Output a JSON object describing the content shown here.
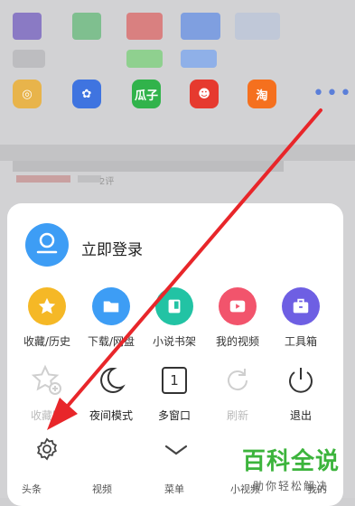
{
  "login": {
    "label": "立即登录"
  },
  "menu_row1": [
    {
      "label": "收藏/历史",
      "icon": "star-icon",
      "color": "#f5b826"
    },
    {
      "label": "下载/网盘",
      "icon": "folder-icon",
      "color": "#3d9df5"
    },
    {
      "label": "小说书架",
      "icon": "book-icon",
      "color": "#22c3a4"
    },
    {
      "label": "我的视频",
      "icon": "play-icon",
      "color": "#f2546c"
    },
    {
      "label": "工具箱",
      "icon": "toolbox-icon",
      "color": "#6e5fe3"
    }
  ],
  "menu_row2": [
    {
      "label": "收藏网",
      "icon": "star-add-icon",
      "enabled": false
    },
    {
      "label": "夜间模式",
      "icon": "moon-icon",
      "enabled": true
    },
    {
      "label": "多窗口",
      "icon": "window-count-icon",
      "count": "1",
      "enabled": true
    },
    {
      "label": "刷新",
      "icon": "refresh-icon",
      "enabled": false
    },
    {
      "label": "退出",
      "icon": "power-icon",
      "enabled": true
    }
  ],
  "bottom_bar": {
    "settings_icon": "gear-icon",
    "collapse_icon": "chevron-down-icon"
  },
  "app_icons": [
    {
      "label": "",
      "icon": "weibo-icon",
      "color": "#e8b44b"
    },
    {
      "label": "",
      "icon": "baidu-icon",
      "color": "#3f74e0"
    },
    {
      "label": "瓜子",
      "icon": "guazi-icon",
      "color": "#31b34b"
    },
    {
      "label": "",
      "icon": "lion-icon",
      "color": "#e63a2f"
    },
    {
      "label": "淘",
      "icon": "taobao-icon",
      "color": "#f5701e"
    }
  ],
  "bottom_nav": [
    "头条",
    "视频",
    "菜单",
    "小视频",
    "我的"
  ],
  "watermark": {
    "title": "百科全说",
    "subtitle": "助你轻松解决"
  },
  "news": {
    "meta": "2评"
  }
}
